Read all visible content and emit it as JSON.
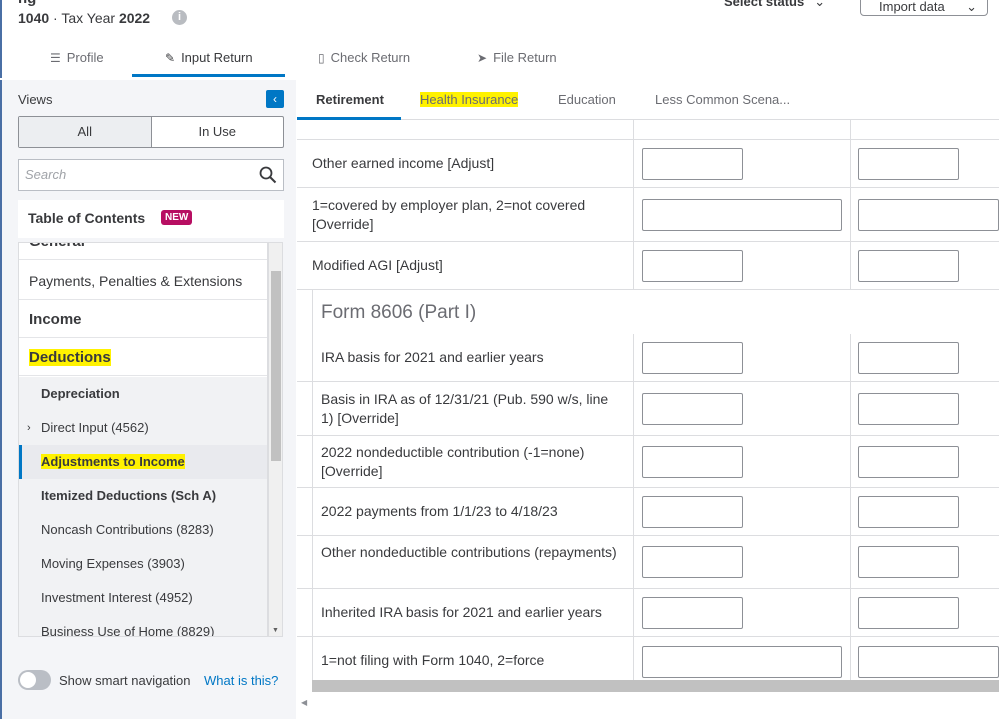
{
  "header": {
    "title_cut": "ng",
    "form": "1040",
    "separator": " · Tax Year ",
    "year": "2022",
    "info_icon": "i",
    "select_status": "Select status",
    "import_label": "Import data"
  },
  "main_tabs": [
    {
      "label": "Profile",
      "icon": "list-icon"
    },
    {
      "label": "Input Return",
      "icon": "pencil-icon"
    },
    {
      "label": "Check Return",
      "icon": "document-icon"
    },
    {
      "label": "File Return",
      "icon": "paper-plane-icon"
    }
  ],
  "sidebar": {
    "views_label": "Views",
    "seg_all": "All",
    "seg_in_use": "In Use",
    "search_placeholder": "Search",
    "toc_label": "Table of Contents",
    "toc_badge": "NEW",
    "nav": [
      {
        "label": "General"
      },
      {
        "label": "Payments, Penalties & Extensions"
      },
      {
        "label": "Income"
      },
      {
        "label": "Deductions"
      },
      {
        "label": "Depreciation"
      },
      {
        "label": "Direct Input (4562)"
      },
      {
        "label": "Adjustments to Income"
      },
      {
        "label": "Itemized Deductions (Sch A)"
      },
      {
        "label": "Noncash Contributions (8283)"
      },
      {
        "label": "Moving Expenses (3903)"
      },
      {
        "label": "Investment Interest (4952)"
      },
      {
        "label": "Business Use of Home (8829)"
      }
    ],
    "smart_nav_label": "Show smart navigation",
    "smart_nav_link": "What is this?"
  },
  "sub_tabs": [
    "Retirement",
    "Health Insurance",
    "Education",
    "Less Common Scena..."
  ],
  "rows": [
    {
      "label": "Other earned income [Adjust]"
    },
    {
      "label": "1=covered by employer plan, 2=not covered [Override]"
    },
    {
      "label": "Modified AGI [Adjust]"
    }
  ],
  "section": {
    "title": "Form 8606 (Part I)",
    "rows": [
      {
        "label": "IRA basis for 2021 and earlier years"
      },
      {
        "label": "Basis in IRA as of 12/31/21 (Pub. 590 w/s, line 1) [Override]"
      },
      {
        "label": "2022 nondeductible contribution (-1=none) [Override]"
      },
      {
        "label": "2022 payments from 1/1/23 to 4/18/23"
      },
      {
        "label": "Other nondeductible contributions (repayments)"
      },
      {
        "label": "Inherited IRA basis for 2021 and earlier years"
      },
      {
        "label": "1=not filing with Form 1040, 2=force"
      }
    ]
  },
  "colors": {
    "accent": "#0077c5",
    "highlight": "#fff200",
    "badge": "#b70e62"
  }
}
